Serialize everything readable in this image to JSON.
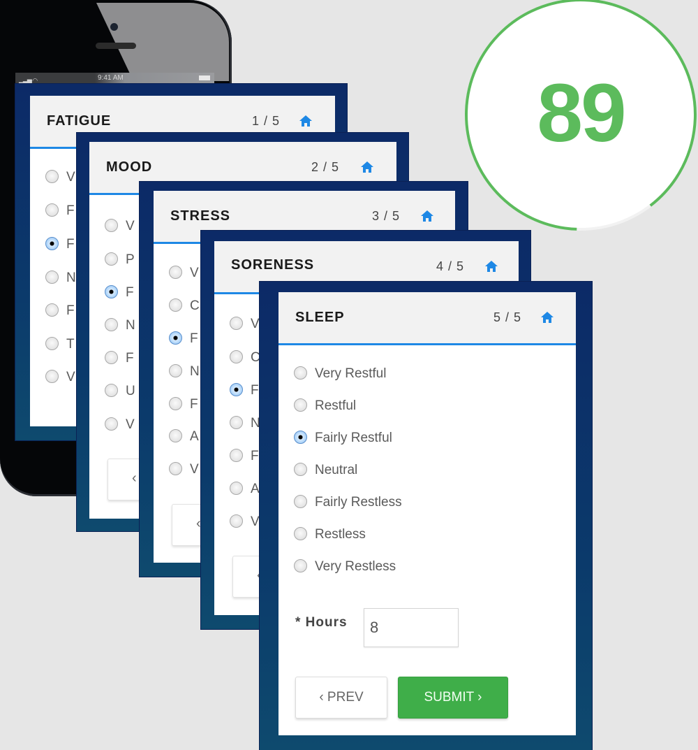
{
  "phone": {
    "status_time": "9:41 AM"
  },
  "colors": {
    "card_frame": "#0c2a67",
    "header_underline": "#1e88e5",
    "home_icon": "#1e88e5",
    "submit_green": "#3fae49",
    "score_green": "#5cbb5c",
    "background": "#e6e6e6"
  },
  "cards": [
    {
      "title": "FATIGUE",
      "step": "1 / 5",
      "options_visible_initials": [
        "V",
        "F",
        "F",
        "N",
        "F",
        "T",
        "V"
      ],
      "selected_index": 2
    },
    {
      "title": "MOOD",
      "step": "2 / 5",
      "options_visible_initials": [
        "V",
        "P",
        "F",
        "N",
        "F",
        "U",
        "V"
      ],
      "selected_index": 2,
      "prev_button_glyph": "‹"
    },
    {
      "title": "STRESS",
      "step": "3 / 5",
      "options_visible_initials": [
        "V",
        "C",
        "F",
        "N",
        "F",
        "A",
        "V"
      ],
      "selected_index": 2,
      "prev_button_glyph": "‹"
    },
    {
      "title": "SORENESS",
      "step": "4 / 5",
      "options_visible_initials": [
        "V",
        "C",
        "F",
        "N",
        "F",
        "A",
        "V"
      ],
      "selected_index": 2,
      "prev_button_glyph": "‹"
    },
    {
      "title": "SLEEP",
      "step": "5 / 5",
      "options": [
        "Very Restful",
        "Restful",
        "Fairly Restful",
        "Neutral",
        "Fairly Restless",
        "Restless",
        "Very Restless"
      ],
      "selected_index": 2,
      "hours_label": "* Hours",
      "hours_value": "8",
      "prev_label": "‹ PREV",
      "submit_label": "SUBMIT ›"
    }
  ],
  "score": {
    "value": "89",
    "ring_fill_fraction": 0.89
  }
}
